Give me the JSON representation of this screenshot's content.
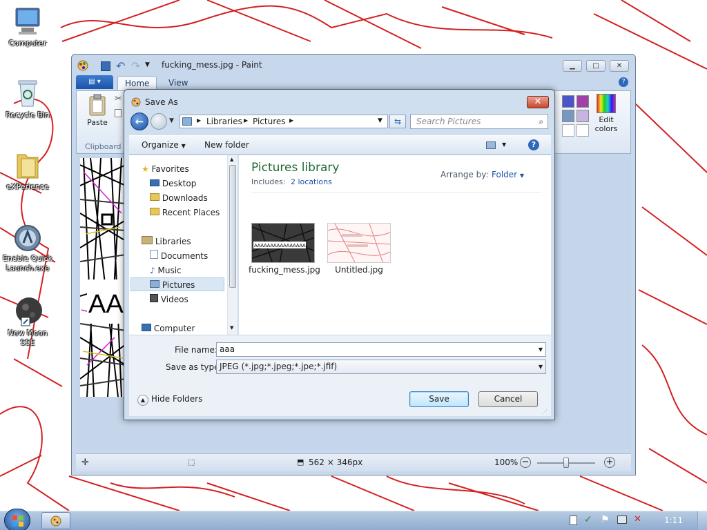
{
  "desktop": {
    "icons": [
      {
        "label": "Computer"
      },
      {
        "label": "Recycle Bin"
      },
      {
        "label": "eXPerience"
      },
      {
        "label": "Enable Quick Launch.exe"
      },
      {
        "label": "New Moon SSE"
      }
    ]
  },
  "paint": {
    "title": "fucking_mess.jpg - Paint",
    "tabs": {
      "home": "Home",
      "view": "View"
    },
    "ribbon": {
      "paste": "Paste",
      "clipboard": "Clipboard",
      "edit_colors": "Edit colors"
    },
    "canvas_text": "AA",
    "status": {
      "size": "562 × 346px",
      "zoom": "100%"
    }
  },
  "dialog": {
    "title": "Save As",
    "breadcrumb": [
      "Libraries",
      "Pictures"
    ],
    "search_placeholder": "Search Pictures",
    "commands": {
      "organize": "Organize",
      "new_folder": "New folder"
    },
    "nav": {
      "favorites": "Favorites",
      "desktop": "Desktop",
      "downloads": "Downloads",
      "recent": "Recent Places",
      "libraries": "Libraries",
      "documents": "Documents",
      "music": "Music",
      "pictures": "Pictures",
      "videos": "Videos",
      "computer": "Computer"
    },
    "library": {
      "title": "Pictures library",
      "includes_label": "Includes:",
      "includes_link": "2 locations",
      "arrange_label": "Arrange by:",
      "arrange_value": "Folder"
    },
    "files": [
      {
        "name": "fucking_mess.jpg",
        "thumb_text": "AAAAAAAAAAAAAAAA"
      },
      {
        "name": "Untitled.jpg"
      }
    ],
    "file_name_label": "File name:",
    "file_name_value": "aaa",
    "save_type_label": "Save as type:",
    "save_type_value": "JPEG (*.jpg;*.jpeg;*.jpe;*.jfif)",
    "hide_folders": "Hide Folders",
    "save": "Save",
    "cancel": "Cancel"
  },
  "taskbar": {
    "clock": "1:11"
  },
  "colors": {
    "wallpaper_line": "#d42020",
    "accent": "#1a54a8",
    "library_title": "#1e6b30"
  }
}
